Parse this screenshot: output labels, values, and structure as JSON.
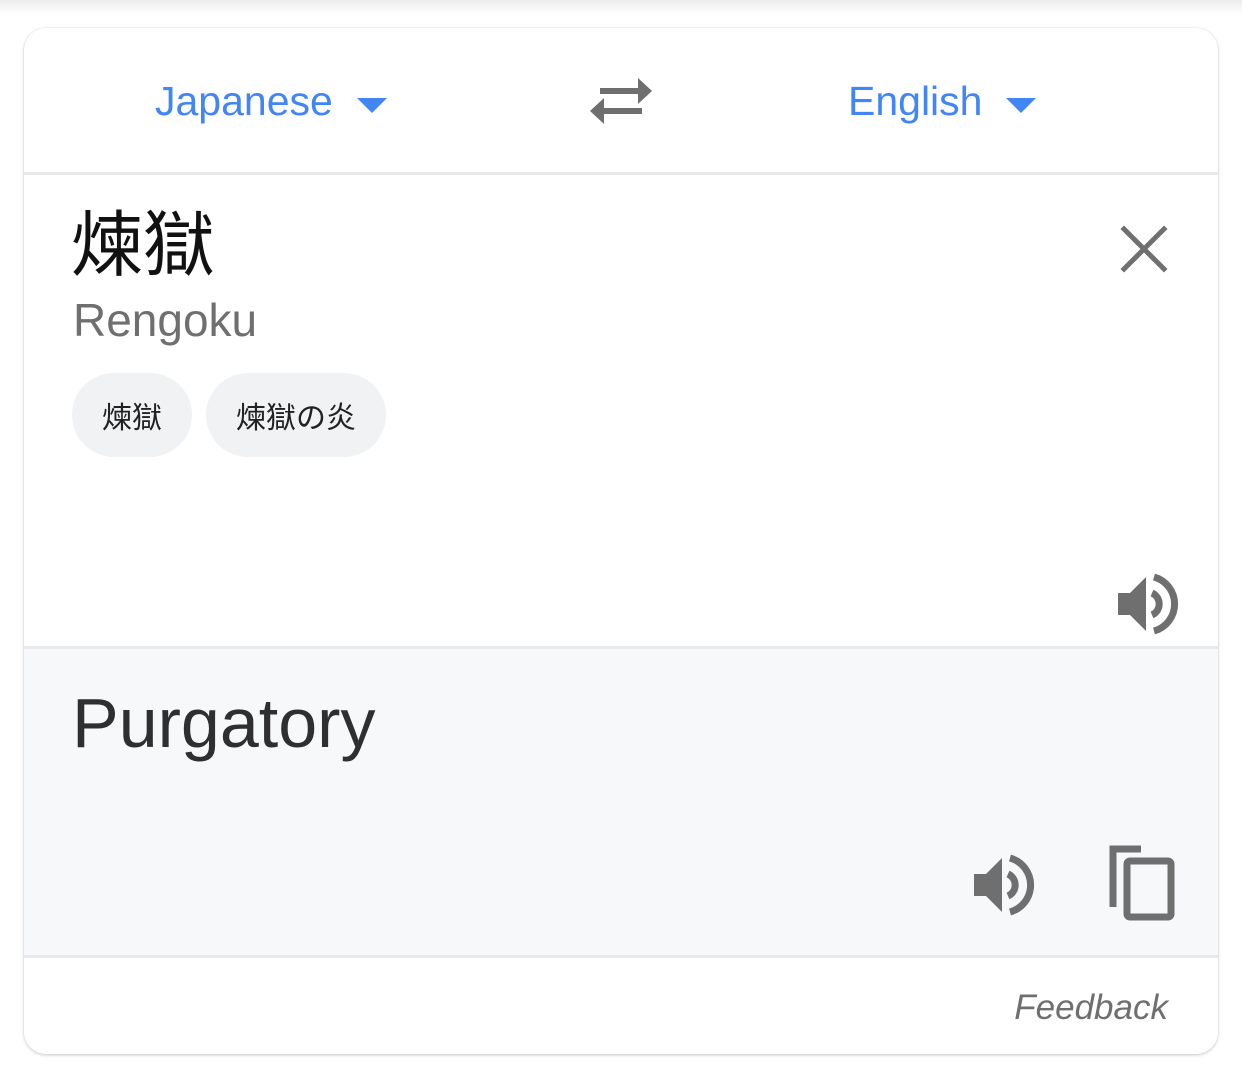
{
  "languages": {
    "source": "Japanese",
    "target": "English"
  },
  "input": {
    "text": "煉獄",
    "romanization": "Rengoku",
    "suggestions": [
      "煉獄",
      "煉獄の炎"
    ]
  },
  "output": {
    "text": "Purgatory"
  },
  "footer": {
    "feedback_label": "Feedback"
  },
  "icons": {
    "source_dropdown": "chevron-down-icon",
    "target_dropdown": "chevron-down-icon",
    "swap": "swap-languages-icon",
    "clear": "close-icon",
    "listen_source": "speaker-icon",
    "listen_target": "speaker-icon",
    "copy": "copy-icon"
  },
  "colors": {
    "accent": "#4285f4",
    "icon": "#6f6f6f",
    "result_background": "#f7f8fa"
  }
}
